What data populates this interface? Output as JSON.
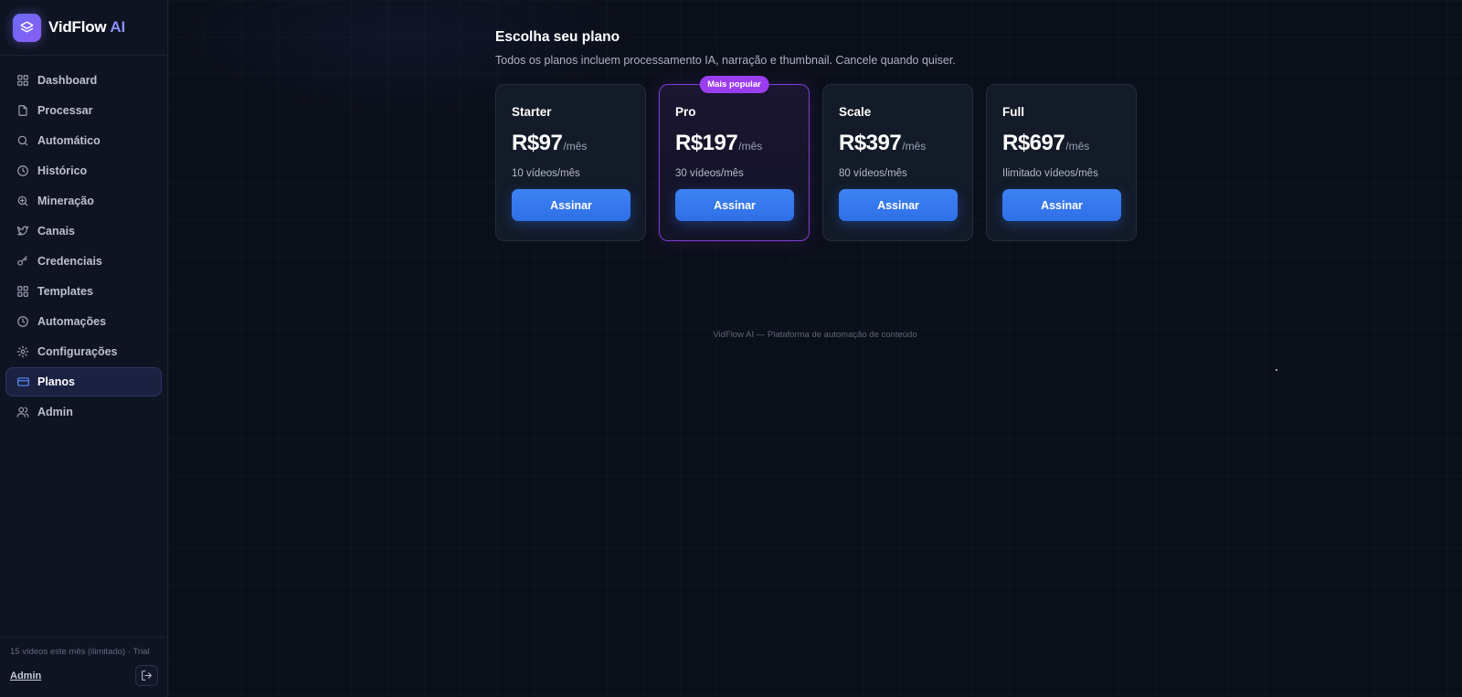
{
  "brand": {
    "name": "VidFlow",
    "accent": "AI",
    "logo_icon": "layers-icon"
  },
  "sidebar": {
    "items": [
      {
        "label": "Dashboard",
        "icon": "grid-icon",
        "active": false
      },
      {
        "label": "Processar",
        "icon": "file-icon",
        "active": false
      },
      {
        "label": "Automático",
        "icon": "search-icon",
        "active": false
      },
      {
        "label": "Histórico",
        "icon": "clock-icon",
        "active": false
      },
      {
        "label": "Mineração",
        "icon": "zoom-icon",
        "active": false
      },
      {
        "label": "Canais",
        "icon": "twitter-icon",
        "active": false
      },
      {
        "label": "Credenciais",
        "icon": "key-icon",
        "active": false
      },
      {
        "label": "Templates",
        "icon": "grid-icon",
        "active": false
      },
      {
        "label": "Automações",
        "icon": "clock-icon",
        "active": false
      },
      {
        "label": "Configurações",
        "icon": "gear-icon",
        "active": false
      },
      {
        "label": "Planos",
        "icon": "credit-card-icon",
        "active": true
      },
      {
        "label": "Admin",
        "icon": "users-icon",
        "active": false
      }
    ],
    "footer": {
      "usage": "15 vídeos este mês (ilimitado) · Trial",
      "user": "Admin",
      "logout_icon": "logout-icon"
    }
  },
  "main": {
    "title": "Escolha seu plano",
    "subtitle": "Todos os planos incluem processamento IA, narração e thumbnail. Cancele quando quiser.",
    "plans": [
      {
        "name": "Starter",
        "price": "R$97",
        "period": "/mês",
        "quota": "10 vídeos/mês",
        "button": "Assinar",
        "featured": false
      },
      {
        "name": "Pro",
        "price": "R$197",
        "period": "/mês",
        "quota": "30 vídeos/mês",
        "button": "Assinar",
        "featured": true,
        "badge": "Mais popular"
      },
      {
        "name": "Scale",
        "price": "R$397",
        "period": "/mês",
        "quota": "80 vídeos/mês",
        "button": "Assinar",
        "featured": false
      },
      {
        "name": "Full",
        "price": "R$697",
        "period": "/mês",
        "quota": "Ilimitado vídeos/mês",
        "button": "Assinar",
        "featured": false
      }
    ],
    "footer": "VidFlow AI — Plataforma de automação de conteúdo"
  },
  "colors": {
    "background": "#0b0f1a",
    "sidebar": "#0f1422",
    "accent_blue": "#3d82f4",
    "featured_purple": "#9b3df0"
  }
}
